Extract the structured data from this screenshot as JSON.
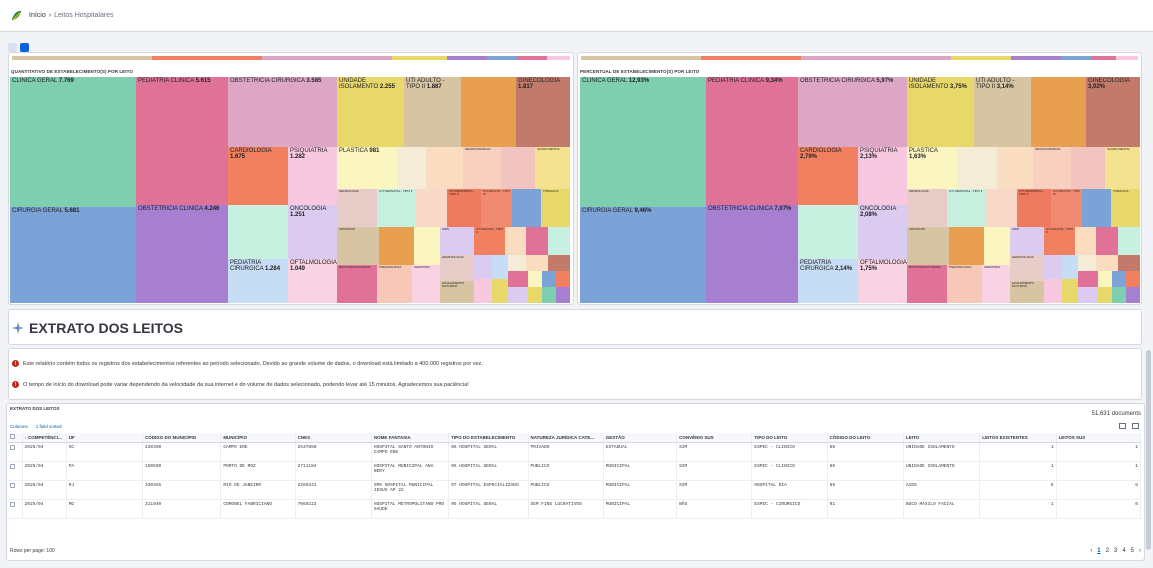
{
  "breadcrumb": {
    "home": "Início",
    "separator": "›",
    "current": "Leitos Hospitalares"
  },
  "logo_icon": "flag-leaf-icon",
  "charts": {
    "left_title": "QUANTITATIVO DE ESTABELECIMENTO(S) POR LEITO",
    "right_title": "PERCENTUAL DE ESTABELECIMENTO(S) POR LEITO"
  },
  "chart_data": [
    {
      "type": "treemap",
      "title": "QUANTITATIVO DE ESTABELECIMENTO(S) POR LEITO",
      "items": [
        {
          "label": "CLINICA GERAL",
          "value": "7.769",
          "color": "#7ecfb0"
        },
        {
          "label": "CIRURGIA GERAL",
          "value": "5.681",
          "color": "#7ca3d8"
        },
        {
          "label": "PEDIATRIA CLINICA",
          "value": "5.615",
          "color": "#e07298"
        },
        {
          "label": "OBSTETRICIA CLINICA",
          "value": "4.246",
          "color": "#a67fd1"
        },
        {
          "label": "OBSTETRICIA CIRURGICA",
          "value": "3.585",
          "color": "#dea6c5"
        },
        {
          "label": "UNIDADE ISOLAMENTO",
          "value": "2.255",
          "color": "#e8d86a"
        },
        {
          "label": "UTI ADULTO - TIPO II",
          "value": "1.887",
          "color": "#d6c4a2"
        },
        {
          "label": "GINECOLOGIA",
          "value": "1.817",
          "color": "#c27a6a"
        },
        {
          "label": "CARDIOLOGIA",
          "value": "1.675",
          "color": "#f08060"
        },
        {
          "label": "PSIQUIATRIA",
          "value": "1.282",
          "color": "#f7c8e0"
        },
        {
          "label": "PLASTICA",
          "value": "981",
          "color": "#fbf6c0"
        },
        {
          "label": "ONCOLOGIA",
          "value": "1.251",
          "color": "#dccbf0"
        },
        {
          "label": "PEDIATRIA CIRURGICA",
          "value": "1.284",
          "color": "#c7dcf5"
        },
        {
          "label": "OFTALMOLOGIA",
          "value": "1.049",
          "color": "#f9d2e4"
        }
      ]
    },
    {
      "type": "treemap",
      "title": "PERCENTUAL DE ESTABELECIMENTO(S) POR LEITO",
      "items": [
        {
          "label": "CLINICA GERAL",
          "value": "12,93%"
        },
        {
          "label": "CIRURGIA GERAL",
          "value": "9,46%"
        },
        {
          "label": "PEDIATRIA CLINICA",
          "value": "9,34%"
        },
        {
          "label": "OBSTETRICIA CLINICA",
          "value": "7,07%"
        },
        {
          "label": "OBSTETRICIA CIRURGICA",
          "value": "5,97%"
        },
        {
          "label": "UNIDADE ISOLAMENTO",
          "value": "3,75%"
        },
        {
          "label": "UTI ADULTO - TIPO II",
          "value": "3,14%"
        },
        {
          "label": "GINECOLOGIA",
          "value": "3,02%"
        },
        {
          "label": "CARDIOLOGIA",
          "value": "2,79%"
        },
        {
          "label": "PSIQUIATRIA",
          "value": "2,13%"
        },
        {
          "label": "PLASTICA",
          "value": "1,63%"
        },
        {
          "label": "ONCOLOGIA",
          "value": "2,08%"
        },
        {
          "label": "PEDIATRIA CIRURGICA",
          "value": "2,14%"
        },
        {
          "label": "OFTALMOLOGIA",
          "value": "1,75%"
        }
      ]
    }
  ],
  "small_labels": {
    "neurocirurgia": "NEUROCIRURGIA",
    "saude_mental": "SAUDE MENTAL",
    "nefrologia": "NEFROLOGIA",
    "uti_neonatal": "UTI NEONATAL - TIPO II",
    "uti_ped": "UTI PEDIATRICA - TIPO II",
    "uti_adulto_iii": "UTI ADULTO - TIPO III",
    "toracica": "TORACICA",
    "cronicos": "CRONICOS",
    "aids": "AIDS",
    "uti_adulto_ii_cov": "UTI ADULTO - TIPO II",
    "hematologia": "HEMATOLOGIA",
    "buco": "BUCO MAXILO FACIAL",
    "pneumologia": "PNEUMOLOGIA",
    "geriatria": "GERIATRIA",
    "acolhimento": "ACOLHIMENTO NOTURNO"
  },
  "section": {
    "title": "EXTRATO DOS LEITOS",
    "icon": "sparkle-icon"
  },
  "notes": [
    "Este relatório contém todos os registros dos estabelecimentos referentes ao período selecionado. Devido ao grande volume de dados, o download está limitado a 400.000 registros por vez.",
    "O tempo de início do download pode variar dependendo da velocidade da sua internet e do volume de dados selecionado, podendo levar até 15 minutos. Agradecemos sua paciência!"
  ],
  "grid": {
    "title": "EXTRATO DOS LEITOS",
    "doc_count": "51,631 documents",
    "columns_btn": "Columns",
    "sorted_btn": "1 field sorted",
    "headers": [
      "↓ COMPETÊNCI...",
      "UF",
      "CÓDIGO DO MUNICÍPIO",
      "MUNICÍPIO",
      "CNES",
      "NOME FANTASIA",
      "TIPO DO ESTABELECIMENTO",
      "NATUREZA JURÍDICA CATE...",
      "GESTÃO",
      "CONVÊNIO SUS",
      "TIPO DO LEITO",
      "CÓDIGO DO LEITO",
      "LEITO",
      "LEITOS EXISTENTES",
      "LEITOS SUS"
    ],
    "rows": [
      [
        "2025/04",
        "SC",
        "420350",
        "CAMPO ERE",
        "2537850",
        "HOSPITAL SANTO ANTONIO CAMPO ERE",
        "05 HOSPITAL GERAL",
        "PRIVADO",
        "ESTADUAL",
        "SIM",
        "ESPEC - CLINICO",
        "66",
        "UNIDADE ISOLAMENTO",
        "1",
        "1"
      ],
      [
        "2025/04",
        "PA",
        "150590",
        "PORTO DE MOZ",
        "2711184",
        "HOSPITAL MUNICIPAL ANA NERY",
        "05 HOSPITAL GERAL",
        "PUBLICO",
        "MUNICIPAL",
        "SIM",
        "ESPEC - CLINICO",
        "66",
        "UNIDADE ISOLAMENTO",
        "1",
        "1"
      ],
      [
        "2025/04",
        "RJ",
        "330455",
        "RIO DE JANEIRO",
        "2269341",
        "SMS HOSPITAL MUNICIPAL JESUS AP 22",
        "07 HOSPITAL ESPECIALIZADO",
        "PUBLICO",
        "MUNICIPAL",
        "SIM",
        "HOSPITAL DIA",
        "69",
        "AIDS",
        "6",
        "6"
      ],
      [
        "2025/04",
        "MG",
        "311940",
        "CORONEL FABRICIANO",
        "7069223",
        "HOSPITAL METROPOLITANO PRO SAUDE",
        "05 HOSPITAL GERAL",
        "SEM FINS LUCRATIVOS",
        "MUNICIPAL",
        "NÃO",
        "ESPEC - CIRURGICO",
        "01",
        "BUCO MAXILO FACIAL",
        "1",
        "0"
      ]
    ],
    "rows_per_page": "Rows per page: 100",
    "pages": [
      "1",
      "2",
      "3",
      "4",
      "5"
    ]
  }
}
